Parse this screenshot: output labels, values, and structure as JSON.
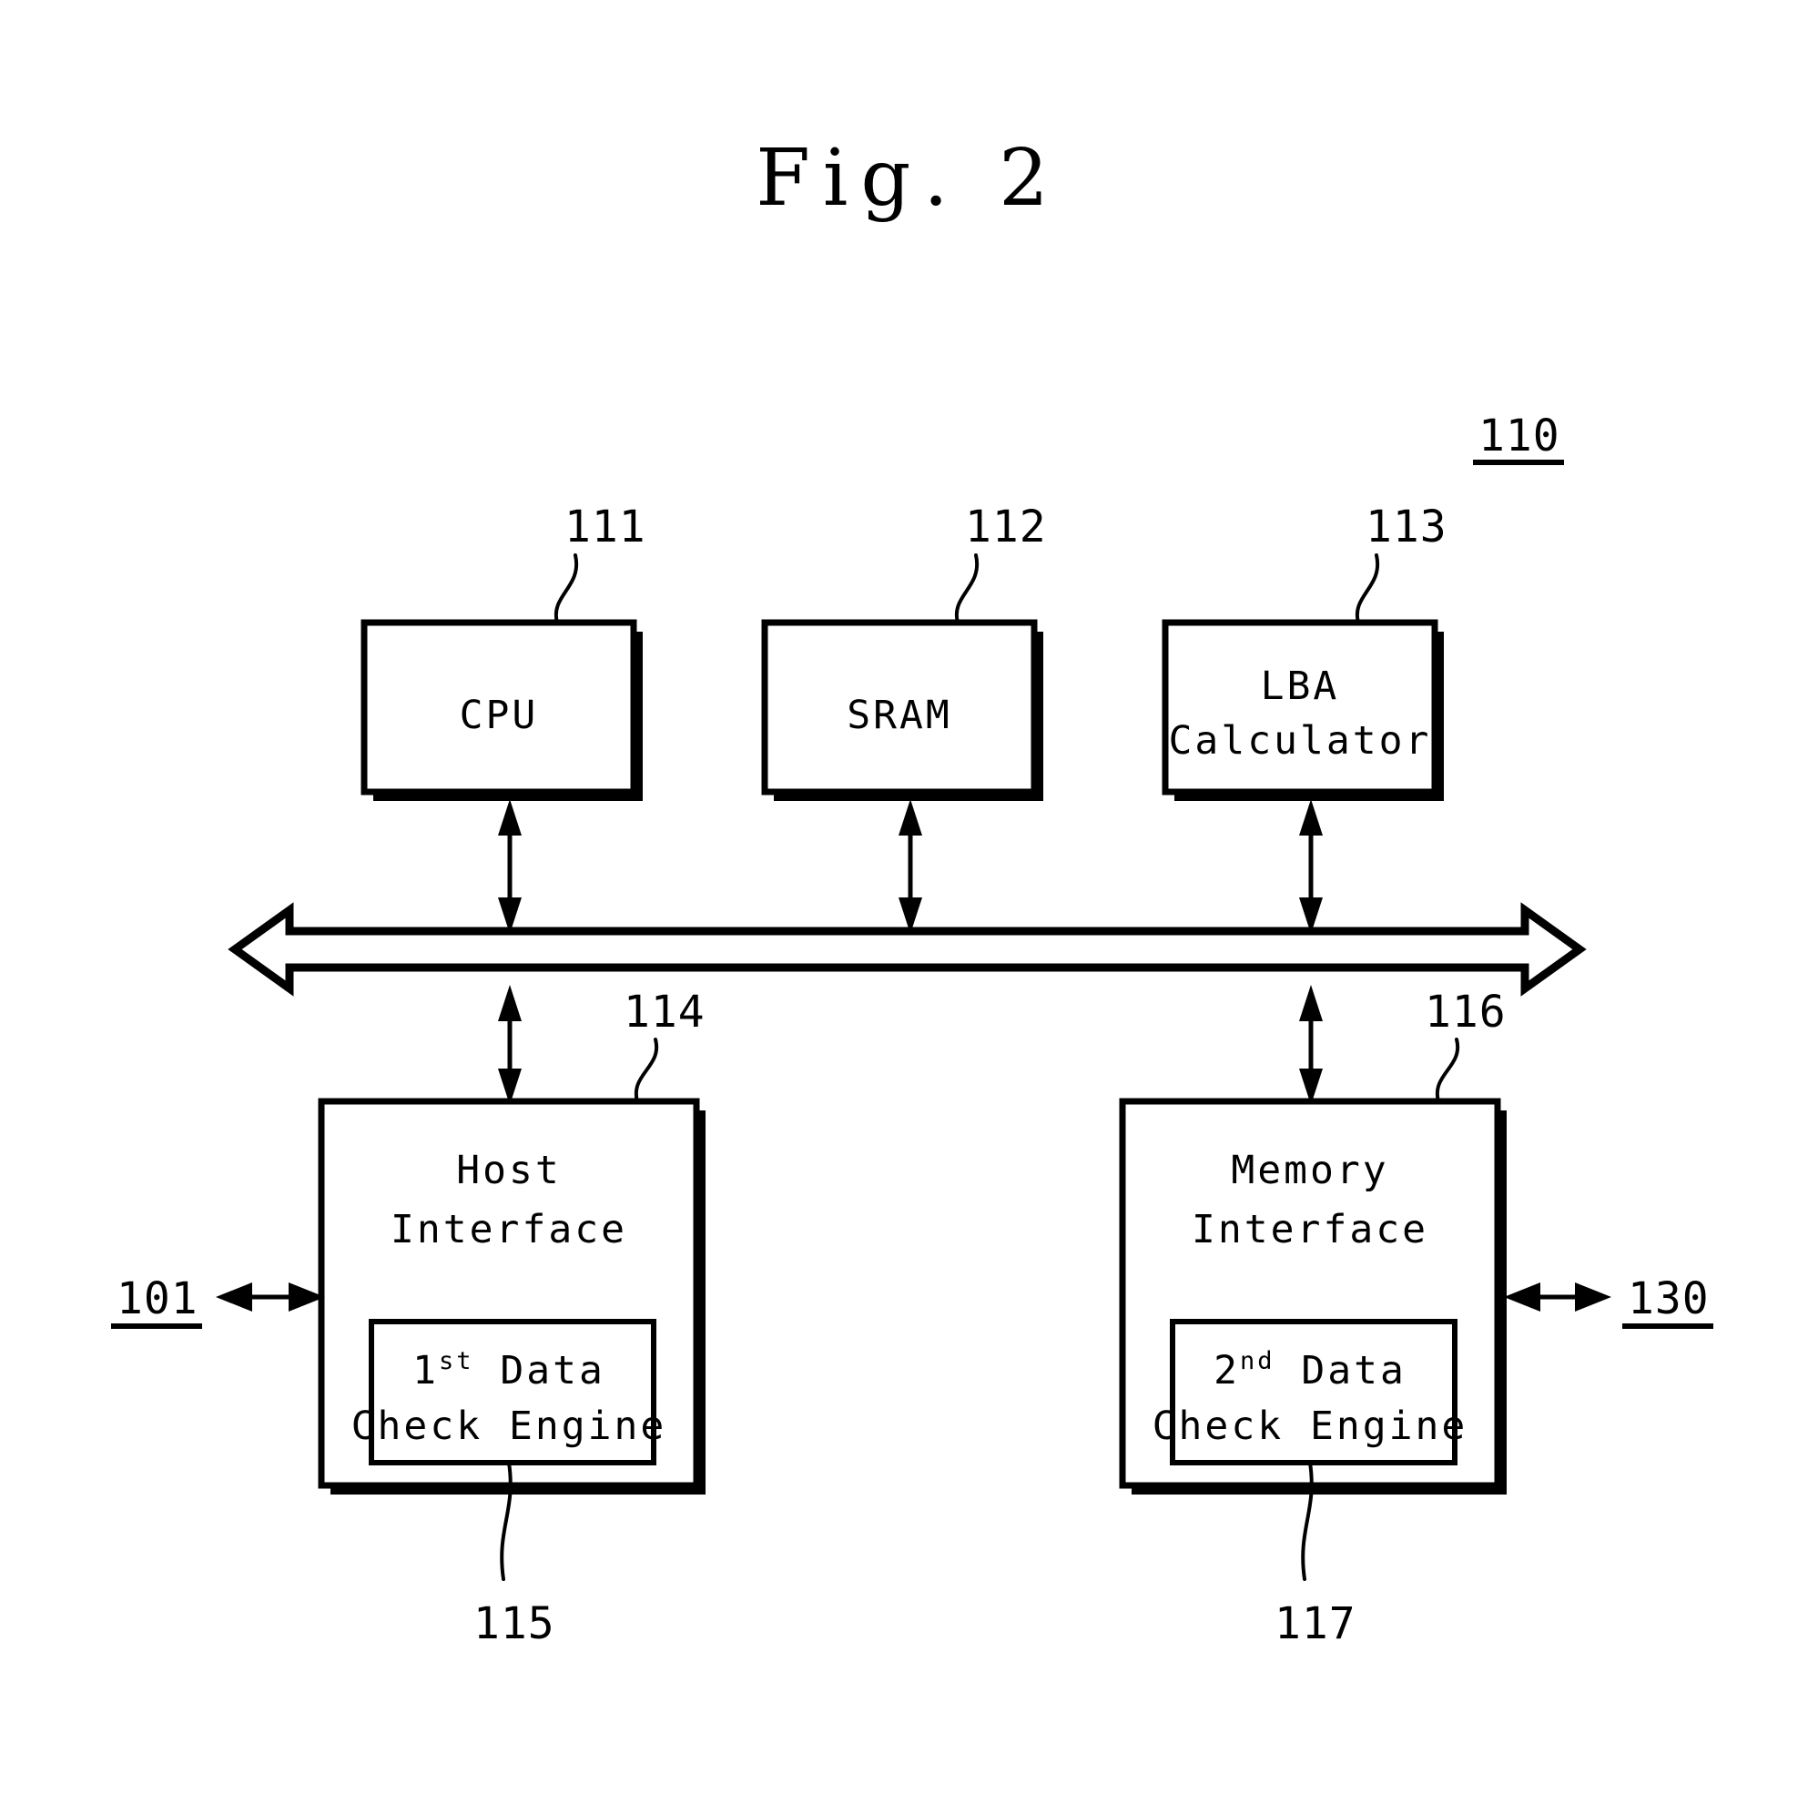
{
  "figure": {
    "title": "Fig. 2",
    "system_ref": "110"
  },
  "blocks": [
    {
      "id": "cpu",
      "label_line1": "CPU",
      "label_line2": "",
      "ref": "111"
    },
    {
      "id": "sram",
      "label_line1": "SRAM",
      "label_line2": "",
      "ref": "112"
    },
    {
      "id": "lba-calculator",
      "label_line1": "LBA",
      "label_line2": "Calculator",
      "ref": "113"
    },
    {
      "id": "host-interface",
      "label_line1": "Host",
      "label_line2": "Interface",
      "ref": "114"
    },
    {
      "id": "memory-interface",
      "label_line1": "Memory",
      "label_line2": "Interface",
      "ref": "116"
    }
  ],
  "inner_blocks": [
    {
      "id": "first-data-check-engine",
      "ordinal": "1",
      "ordinal_sup": "st",
      "label_rest": " Data",
      "label_line2": "Check Engine",
      "ref": "115"
    },
    {
      "id": "second-data-check-engine",
      "ordinal": "2",
      "ordinal_sup": "nd",
      "label_rest": " Data",
      "label_line2": "Check Engine",
      "ref": "117"
    }
  ],
  "external_ports": [
    {
      "id": "host-port",
      "ref": "101",
      "side": "left"
    },
    {
      "id": "memory-port",
      "ref": "130",
      "side": "right"
    }
  ],
  "bus": {
    "id": "system-bus",
    "label": ""
  },
  "colors": {
    "line": "#000000",
    "fill": "#ffffff",
    "shadow": "#000000"
  }
}
